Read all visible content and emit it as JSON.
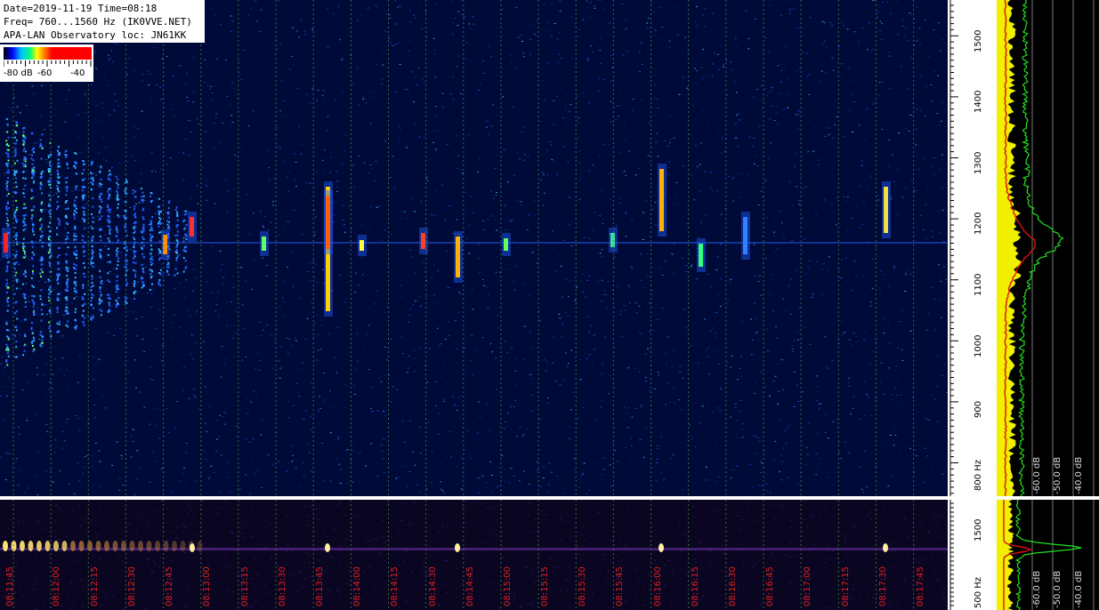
{
  "header": {
    "line1": "Date=2019-11-19 Time=08:18",
    "line2": "Freq= 760...1560 Hz (IK0VVE.NET)",
    "line3": "APA-LAN Observatory loc: JN61KK"
  },
  "colorbar": {
    "label_low": "-80 dB",
    "label_mid": "-60",
    "label_high": "-40"
  },
  "freq_axis": {
    "labels": [
      "1500",
      "1400",
      "1300",
      "1200",
      "1100",
      "1000",
      "900",
      "800 Hz"
    ],
    "bottom_labels": [
      "1500",
      "500 Hz"
    ]
  },
  "spectrum_axis": {
    "labels": [
      "-60.0 dB",
      "-50.0 dB",
      "-40.0 dB"
    ],
    "bottom_labels": [
      "-60.0 dB",
      "-50.0 dB",
      "-40.0 dB"
    ]
  },
  "time_axis": {
    "labels": [
      "08:11:45",
      "08:12:00",
      "08:12:15",
      "08:12:30",
      "08:12:45",
      "08:13:00",
      "08:13:15",
      "08:13:30",
      "08:13:45",
      "08:14:00",
      "08:14:15",
      "08:14:30",
      "08:14:45",
      "08:15:00",
      "08:15:15",
      "08:15:30",
      "08:15:45",
      "08:16:00",
      "08:16:15",
      "08:16:30",
      "08:16:45",
      "08:17:00",
      "08:17:15",
      "08:17:30",
      "08:17:45"
    ]
  },
  "colors": {
    "background": "#000a38",
    "grid": "#3a8a3a",
    "time_label": "#e02020",
    "spectrum_max": "#22e022",
    "spectrum_avg": "#e01010",
    "spectrum_noise": "#f0f000"
  }
}
